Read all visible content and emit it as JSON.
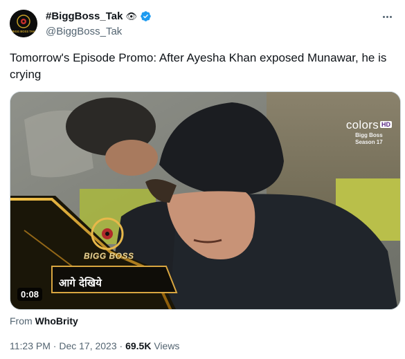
{
  "author": {
    "display_name": "#BiggBoss_Tak",
    "emoji": "👁",
    "handle": "@BiggBoss_Tak",
    "avatar_text": "BIGG BOSS TAK",
    "verified": true
  },
  "tweet": {
    "text": "Tomorrow's Episode Promo: After Ayesha Khan exposed Munawar, he is crying"
  },
  "media": {
    "channel_logo": "colors",
    "channel_hd": "HD",
    "show_line1": "Bigg Boss",
    "show_line2": "Season 17",
    "badge_title": "BIGG BOSS",
    "banner_text": "आगे देखिये",
    "duration": "0:08"
  },
  "from": {
    "prefix": "From",
    "source": "WhoBrity"
  },
  "meta": {
    "time": "11:23 PM",
    "separator": "·",
    "date": "Dec 17, 2023",
    "views_count": "69.5K",
    "views_label": "Views"
  },
  "colors": {
    "verified_blue": "#1d9bf0",
    "text_primary": "#0f1419",
    "text_secondary": "#536471",
    "colors_purple": "#5b2a86"
  },
  "icons": [
    "verified-badge-icon",
    "more-options-icon"
  ]
}
